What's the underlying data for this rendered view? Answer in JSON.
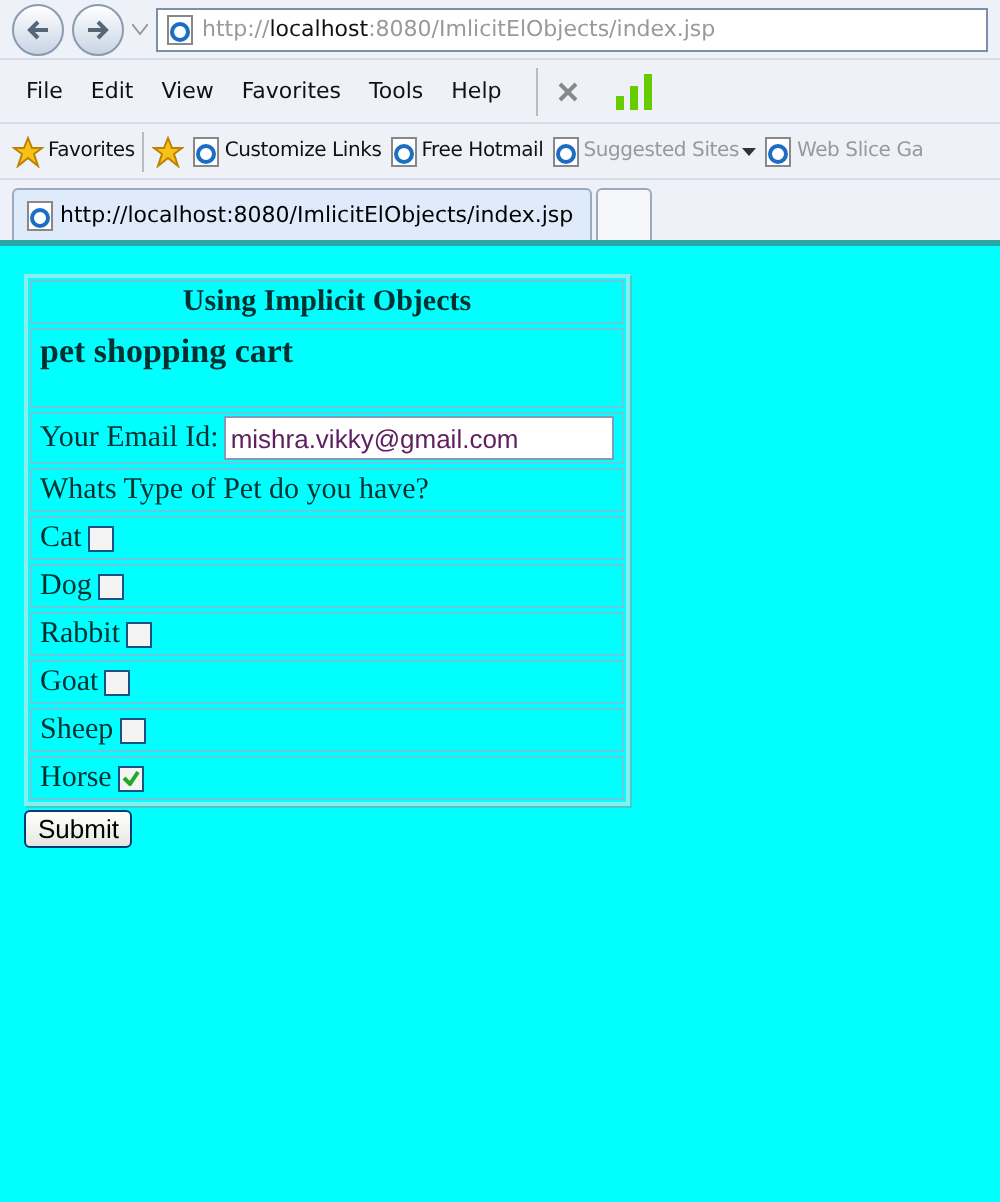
{
  "address_bar": {
    "url": "http://**localhost**:8080/ImlicitElObjects/index.jsp"
  },
  "menu": [
    "File",
    "Edit",
    "View",
    "Favorites",
    "Tools",
    "Help"
  ],
  "favorites_bar": {
    "favorites": "Favorites",
    "links": [
      {
        "label": "Customize Links",
        "disabled": false,
        "dropdown": false
      },
      {
        "label": "Free Hotmail",
        "disabled": false,
        "dropdown": false
      },
      {
        "label": "Suggested Sites",
        "disabled": true,
        "dropdown": true
      },
      {
        "label": "Web Slice Ga",
        "disabled": true,
        "dropdown": false
      }
    ]
  },
  "tabs": [
    {
      "label": "http://localhost:8080/ImlicitElObjects/index.jsp",
      "selected": true
    }
  ],
  "form": {
    "title": "Using Implicit Objects",
    "heading": "pet shopping cart",
    "email_label": "Your Email Id:",
    "email_value": "mishra.vikky@gmail.com",
    "question": "Whats Type of Pet do you have?",
    "pets": [
      {
        "label": "Cat",
        "checked": false
      },
      {
        "label": "Dog",
        "checked": false
      },
      {
        "label": "Rabbit",
        "checked": false
      },
      {
        "label": "Goat",
        "checked": false
      },
      {
        "label": "Sheep",
        "checked": false
      },
      {
        "label": "Horse",
        "checked": true
      }
    ],
    "submit": "Submit"
  }
}
